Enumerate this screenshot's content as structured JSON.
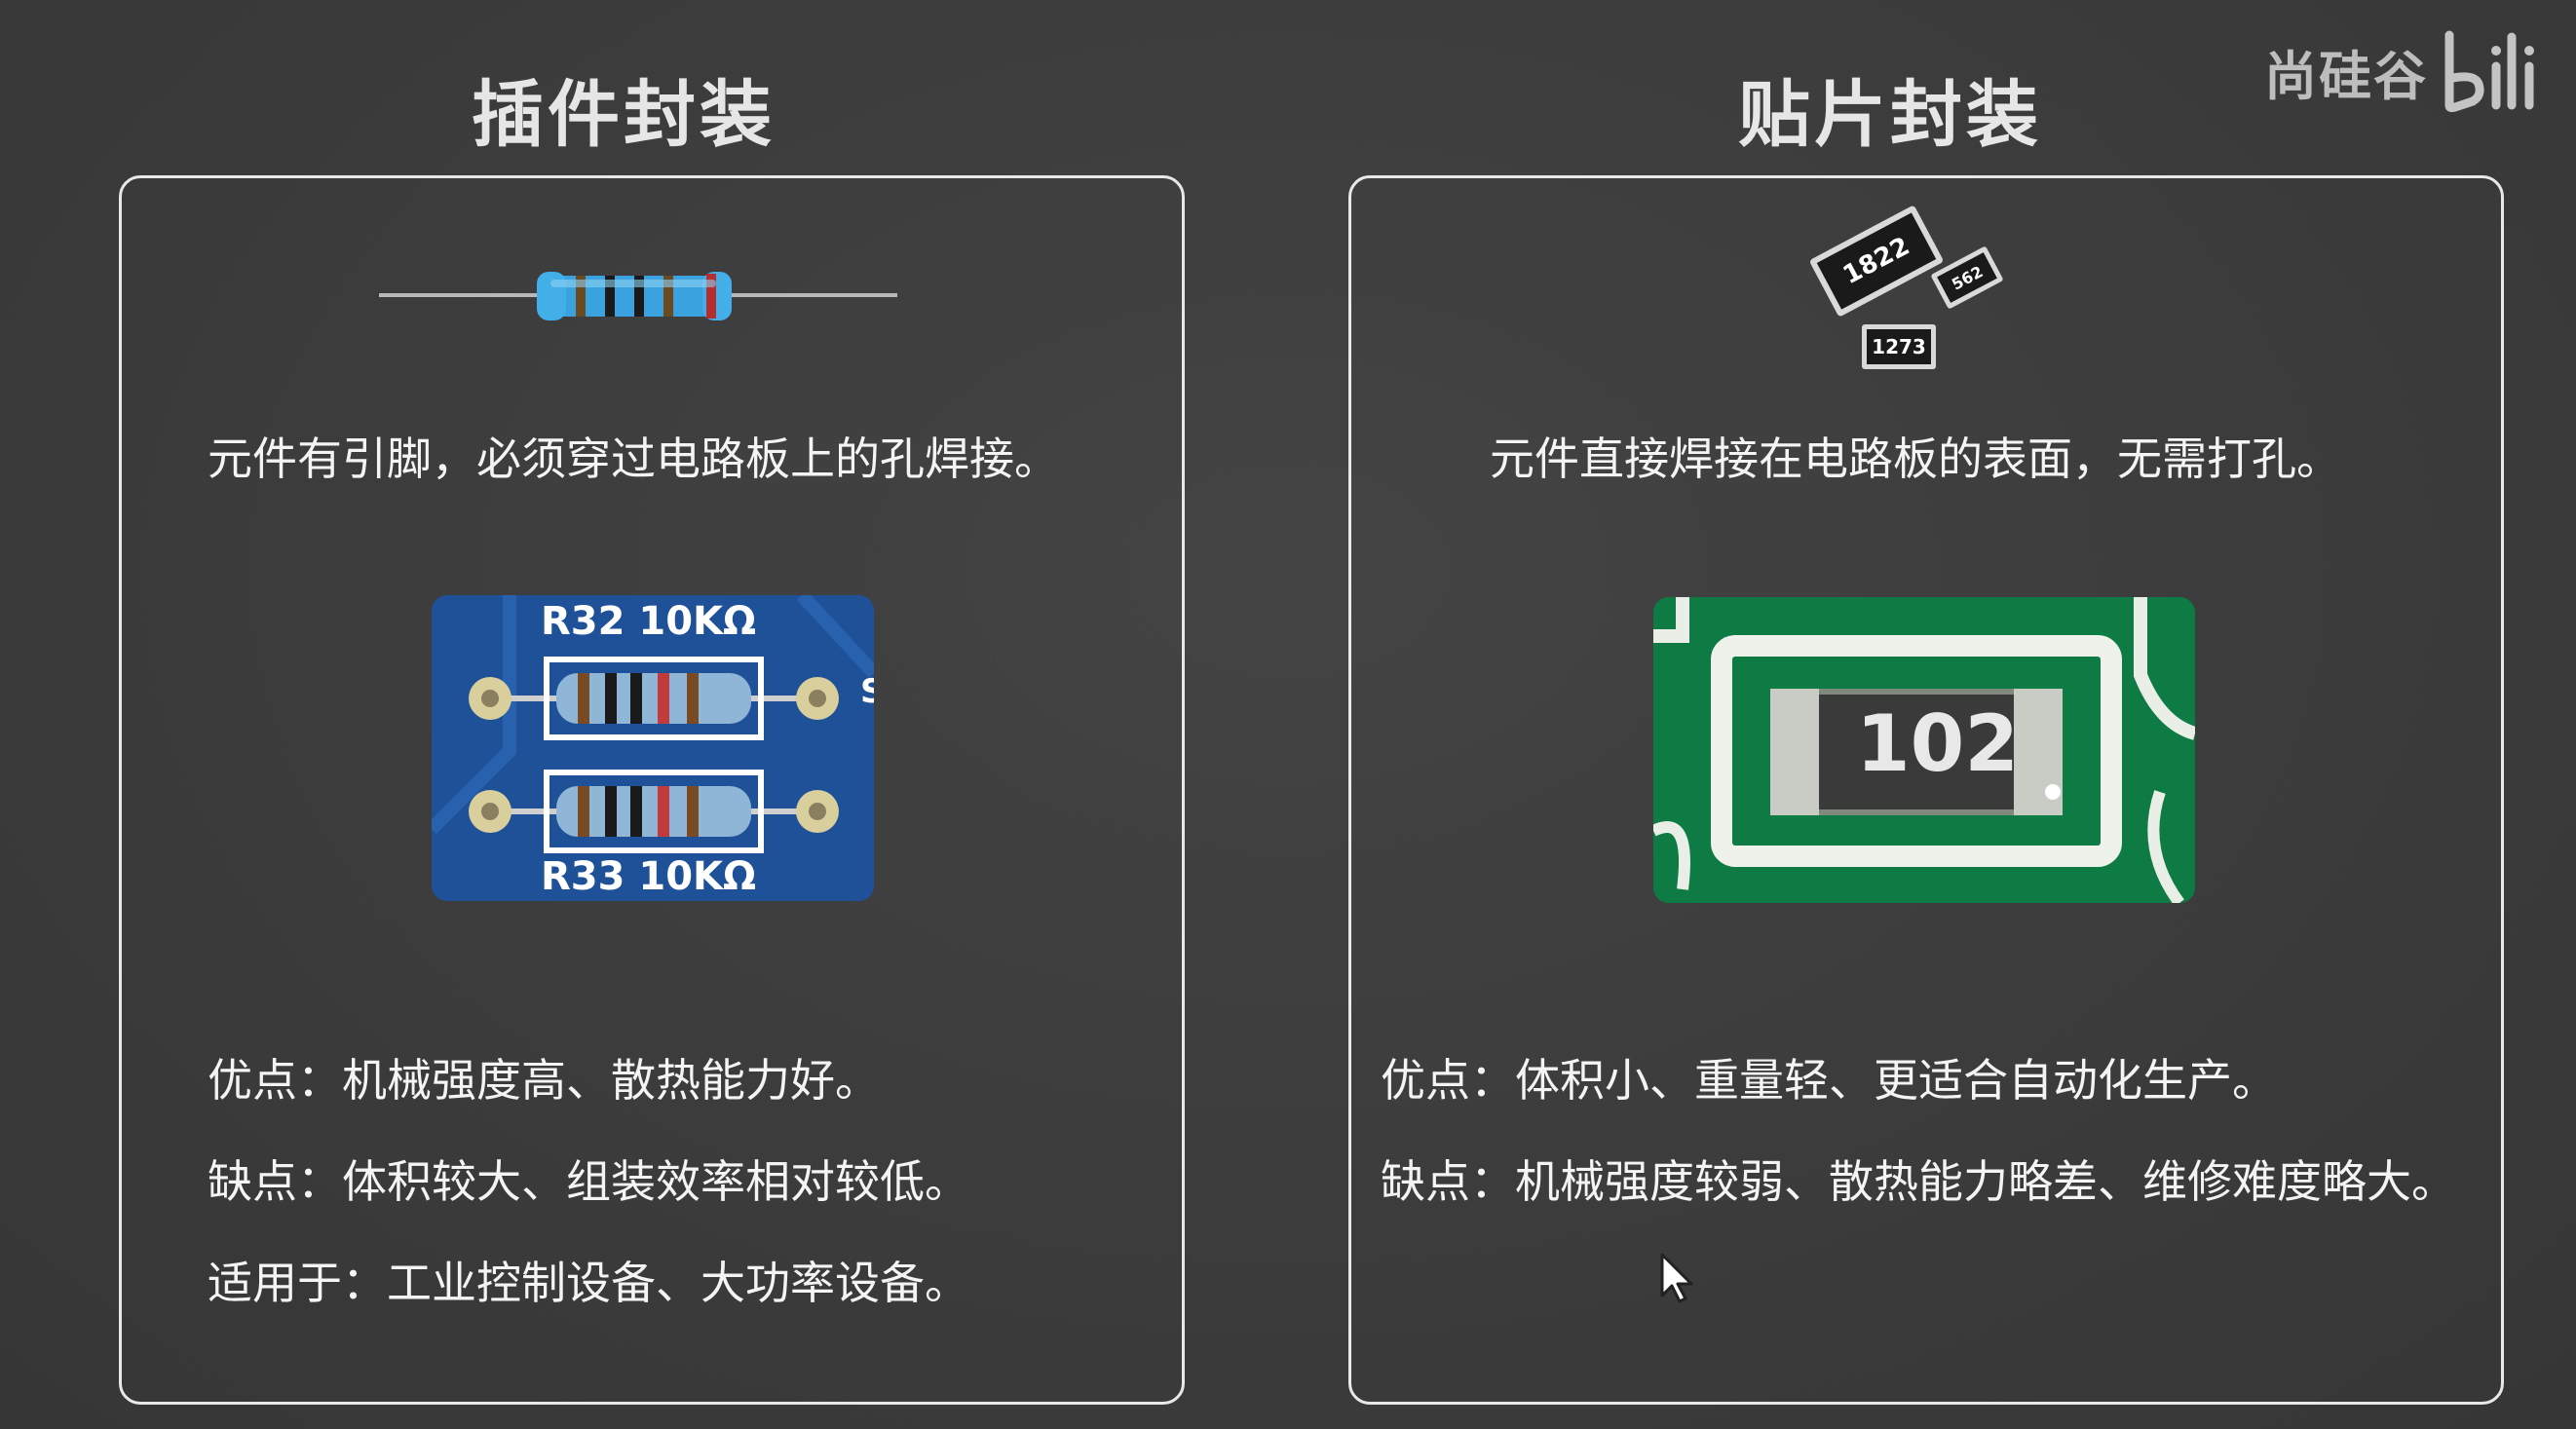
{
  "watermark": {
    "text": "尚硅谷",
    "logo": "bilibili-logo"
  },
  "left": {
    "title": "插件封装",
    "description": "元件有引脚，必须穿过电路板上的孔焊接。",
    "resistor_labels": [
      "R32 10KΩ",
      "R33 10KΩ"
    ],
    "lines": [
      "优点：机械强度高、散热能力好。",
      "缺点：体积较大、组装效率相对较低。",
      "适用于：工业控制设备、大功率设备。"
    ]
  },
  "right": {
    "title": "贴片封装",
    "description": "元件直接焊接在电路板的表面，无需打孔。",
    "chip_codes": [
      "1822",
      "562",
      "1273"
    ],
    "pcb_chip_code": "102",
    "lines": [
      "优点：体积小、重量轻、更适合自动化生产。",
      "缺点：机械强度较弱、散热能力略差、维修难度略大。"
    ]
  },
  "colors": {
    "background": "#3d3d3d",
    "card_border": "#e8e8e8",
    "text": "#f4f4f4",
    "pcb_blue": "#1d4f93",
    "pcb_green": "#0f7a45"
  }
}
